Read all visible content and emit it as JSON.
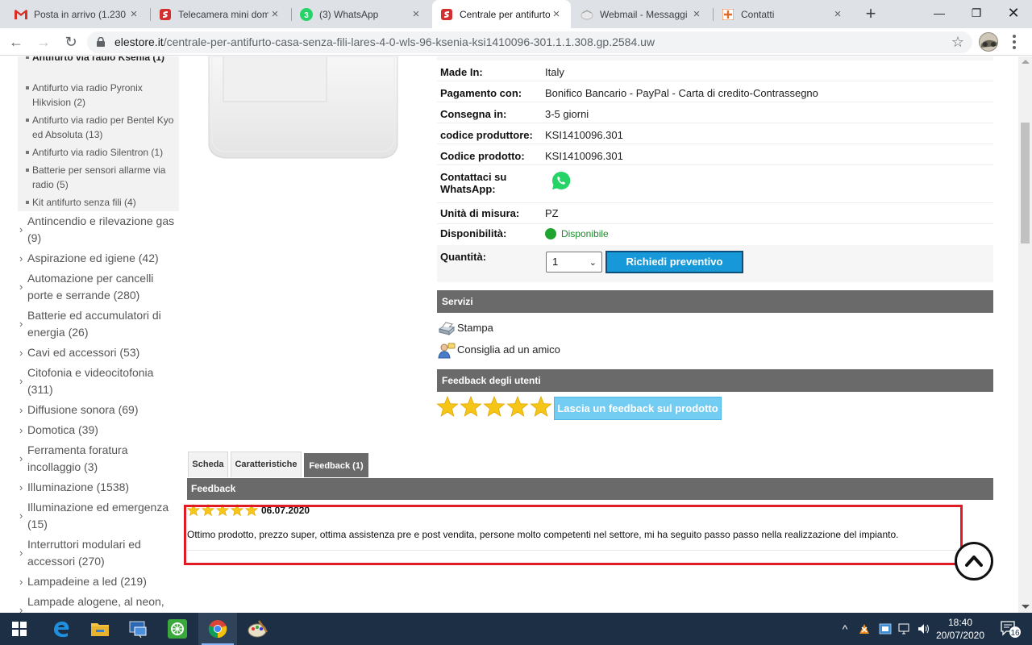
{
  "browser": {
    "tabs": [
      {
        "title": "Posta in arrivo (1.230",
        "icon": "gmail-icon",
        "active": false
      },
      {
        "title": "Telecamera mini dom",
        "icon": "store-icon",
        "active": false
      },
      {
        "title": "(3) WhatsApp",
        "icon": "whatsapp-icon",
        "badge": "3",
        "active": false
      },
      {
        "title": "Centrale per antifurto",
        "icon": "store-icon",
        "active": true
      },
      {
        "title": "Webmail - Messaggi",
        "icon": "webmail-icon",
        "active": false
      },
      {
        "title": "Contatti",
        "icon": "contacts-icon",
        "active": false
      }
    ],
    "url_host": "elestore.it",
    "url_path": "/centrale-per-antifurto-casa-senza-fili-lares-4-0-wls-96-ksenia-ksi1410096-301.1.1.308.gp.2584.uw"
  },
  "sidebar": {
    "subcategories": [
      {
        "label": "Antifurto via radio Ksenia (1)",
        "bold": true
      },
      {
        "label": "Antifurto via radio Pyronix Hikvision (2)"
      },
      {
        "label": "Antifurto via radio per Bentel Kyo ed Absoluta (13)"
      },
      {
        "label": "Antifurto via radio Silentron (1)"
      },
      {
        "label": "Batterie per sensori allarme via radio (5)"
      },
      {
        "label": "Kit antifurto senza fili (4)"
      }
    ],
    "categories": [
      {
        "label": "Antincendio e rilevazione gas (9)"
      },
      {
        "label": "Aspirazione ed igiene (42)"
      },
      {
        "label": "Automazione per cancelli porte e serrande (280)"
      },
      {
        "label": "Batterie ed accumulatori di energia (26)"
      },
      {
        "label": "Cavi ed accessori (53)"
      },
      {
        "label": "Citofonia e videocitofonia (311)"
      },
      {
        "label": "Diffusione sonora (69)"
      },
      {
        "label": "Domotica (39)"
      },
      {
        "label": "Ferramenta foratura incollaggio (3)"
      },
      {
        "label": "Illuminazione (1538)"
      },
      {
        "label": "Illuminazione ed emergenza (15)"
      },
      {
        "label": "Interruttori modulari ed accessori (270)"
      },
      {
        "label": "Lampadeine a led (219)"
      },
      {
        "label": "Lampade alogene, al neon,"
      }
    ]
  },
  "product": {
    "info": [
      {
        "key": "Made In:",
        "value": "Italy"
      },
      {
        "key": "Pagamento con:",
        "value": "Bonifico Bancario - PayPal - Carta di credito-Contrassegno"
      },
      {
        "key": "Consegna in:",
        "value": "3-5 giorni"
      },
      {
        "key": "codice produttore:",
        "value": "KSI1410096.301"
      },
      {
        "key": "Codice prodotto:",
        "value": "KSI1410096.301"
      },
      {
        "key": "Contattaci su WhatsApp:",
        "value": ""
      },
      {
        "key": "Unità di misura:",
        "value": "PZ"
      },
      {
        "key": "Disponibilità:",
        "value": "Disponibile"
      },
      {
        "key": "Quantità:",
        "value": ""
      }
    ],
    "quantity": "1",
    "quote_button": "Richiedi preventivo",
    "services_title": "Servizi",
    "services": [
      {
        "label": "Stampa",
        "icon": "printer-icon"
      },
      {
        "label": "Consiglia ad un amico",
        "icon": "user-recommend-icon"
      }
    ],
    "feedback_title": "Feedback degli utenti",
    "rating_stars": 5,
    "feedback_button": "Lascia un feedback sul prodotto"
  },
  "tabs": [
    {
      "label": "Scheda",
      "active": false
    },
    {
      "label": "Caratteristiche",
      "active": false
    },
    {
      "label": "Feedback (1)",
      "active": true
    }
  ],
  "feedback": {
    "title": "Feedback",
    "reviews": [
      {
        "stars": 5,
        "date": "06.07.2020",
        "text": "Ottimo prodotto, prezzo super, ottima assistenza pre e post vendita, persone molto competenti nel settore, mi ha seguito passo passo nella realizzazione del impianto."
      }
    ]
  },
  "taskbar": {
    "time": "18:40",
    "date": "20/07/2020",
    "notifications": "16"
  },
  "colors": {
    "section_bar": "#6a6a6a",
    "quote_button": "#1798d8",
    "feedback_button": "#73ccf2",
    "available": "#1fa52f",
    "highlight": "#e01b24",
    "star": "#f5c518"
  }
}
